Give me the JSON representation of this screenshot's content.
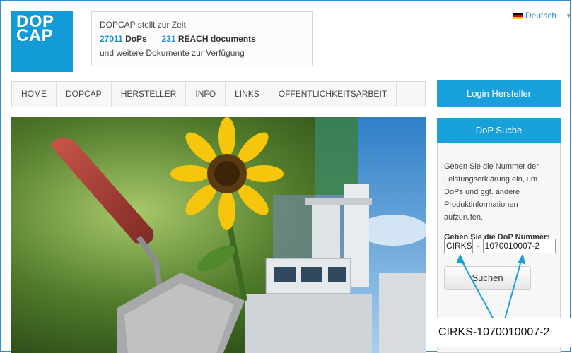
{
  "brand": {
    "logo_line1": "DOP",
    "logo_line2": "CAP",
    "color": "#129bd7"
  },
  "info": {
    "line1": "DOPCAP stellt zur Zeit",
    "dops_count": "27011",
    "dops_label": "DoPs",
    "reach_count": "231",
    "reach_label": "REACH documents",
    "line3": "und weitere Dokumente zur Verfügung"
  },
  "language": {
    "label": "Deutsch",
    "flag": "german-flag-icon"
  },
  "nav": {
    "items": [
      "HOME",
      "DOPCAP",
      "HERSTELLER",
      "INFO",
      "LINKS",
      "ÖFFENTLICHKEITSARBEIT"
    ]
  },
  "sidebar": {
    "login_label": "Login Hersteller",
    "search_title": "DoP Suche",
    "description": "Geben Sie die Nummer der Leistungserklärung ein, um DoPs und ggf. andere Produktinformationen aufzurufen.",
    "input_label": "Geben Sie die DoP Nummer:",
    "prefix_value": "CIRKS",
    "separator": "-",
    "number_value": "1070010007-2",
    "search_button": "Suchen"
  },
  "annotation": {
    "text": "CIRKS-1070010007-2",
    "arrow_color": "#18a0db"
  }
}
